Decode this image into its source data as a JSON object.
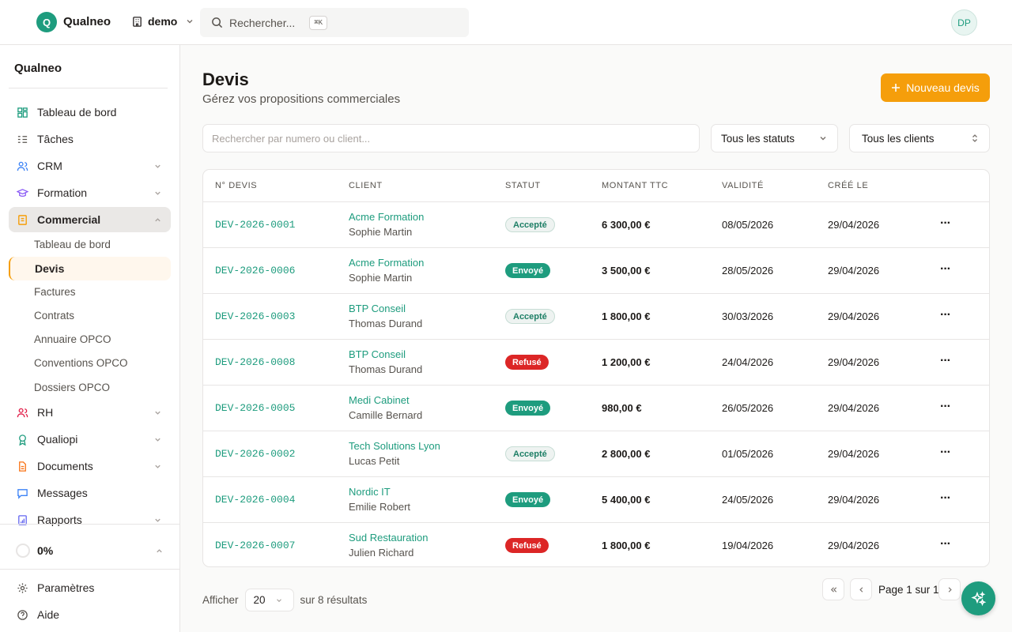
{
  "app": {
    "logo_letter": "Q",
    "brand": "Qualneo",
    "workspace": "demo",
    "search_placeholder": "Rechercher...",
    "search_shortcut": "⌘K",
    "user_initials": "DP"
  },
  "sidebar": {
    "title": "Qualneo",
    "items": [
      {
        "label": "Tableau de bord",
        "icon": "dashboard-icon"
      },
      {
        "label": "Tâches",
        "icon": "tasks-icon"
      },
      {
        "label": "CRM",
        "icon": "users-icon"
      },
      {
        "label": "Formation",
        "icon": "graduation-cap-icon"
      },
      {
        "label": "Commercial",
        "icon": "document-icon"
      }
    ],
    "commercial_sub": [
      "Tableau de bord",
      "Devis",
      "Factures",
      "Contrats",
      "Annuaire OPCO",
      "Conventions OPCO",
      "Dossiers OPCO"
    ],
    "items2": [
      {
        "label": "RH",
        "icon": "people-icon"
      },
      {
        "label": "Qualiopi",
        "icon": "award-icon"
      },
      {
        "label": "Documents",
        "icon": "file-icon"
      },
      {
        "label": "Messages",
        "icon": "message-icon"
      },
      {
        "label": "Rapports",
        "icon": "report-icon"
      }
    ],
    "progress": "0%",
    "settings": "Paramètres",
    "help": "Aide"
  },
  "page": {
    "title": "Devis",
    "subtitle": "Gérez vos propositions commerciales",
    "new_button": "Nouveau devis"
  },
  "filters": {
    "search_placeholder": "Rechercher par numero ou client...",
    "status": "Tous les statuts",
    "clients": "Tous les clients"
  },
  "table": {
    "headers": [
      "N° DEVIS",
      "CLIENT",
      "STATUT",
      "MONTANT TTC",
      "VALIDITÉ",
      "CRÉÉ LE"
    ],
    "rows": [
      {
        "num": "DEV-2026-0001",
        "client": "Acme Formation",
        "contact": "Sophie Martin",
        "status": "Accepté",
        "amount": "6 300,00 €",
        "validity": "08/05/2026",
        "created": "29/04/2026"
      },
      {
        "num": "DEV-2026-0006",
        "client": "Acme Formation",
        "contact": "Sophie Martin",
        "status": "Envoyé",
        "amount": "3 500,00 €",
        "validity": "28/05/2026",
        "created": "29/04/2026"
      },
      {
        "num": "DEV-2026-0003",
        "client": "BTP Conseil",
        "contact": "Thomas Durand",
        "status": "Accepté",
        "amount": "1 800,00 €",
        "validity": "30/03/2026",
        "created": "29/04/2026"
      },
      {
        "num": "DEV-2026-0008",
        "client": "BTP Conseil",
        "contact": "Thomas Durand",
        "status": "Refusé",
        "amount": "1 200,00 €",
        "validity": "24/04/2026",
        "created": "29/04/2026"
      },
      {
        "num": "DEV-2026-0005",
        "client": "Medi Cabinet",
        "contact": "Camille Bernard",
        "status": "Envoyé",
        "amount": "980,00 €",
        "validity": "26/05/2026",
        "created": "29/04/2026"
      },
      {
        "num": "DEV-2026-0002",
        "client": "Tech Solutions Lyon",
        "contact": "Lucas Petit",
        "status": "Accepté",
        "amount": "2 800,00 €",
        "validity": "01/05/2026",
        "created": "29/04/2026"
      },
      {
        "num": "DEV-2026-0004",
        "client": "Nordic IT",
        "contact": "Emilie Robert",
        "status": "Envoyé",
        "amount": "5 400,00 €",
        "validity": "24/05/2026",
        "created": "29/04/2026"
      },
      {
        "num": "DEV-2026-0007",
        "client": "Sud Restauration",
        "contact": "Julien Richard",
        "status": "Refusé",
        "amount": "1 800,00 €",
        "validity": "19/04/2026",
        "created": "29/04/2026"
      }
    ],
    "more": "···"
  },
  "pagination": {
    "show_label": "Afficher",
    "per_page": "20",
    "results": "sur 8 résultats",
    "page_text": "Page 1 sur 1"
  },
  "colors": {
    "accent": "#1e9c7e",
    "orange": "#f59e0b",
    "danger": "#dc2626"
  }
}
